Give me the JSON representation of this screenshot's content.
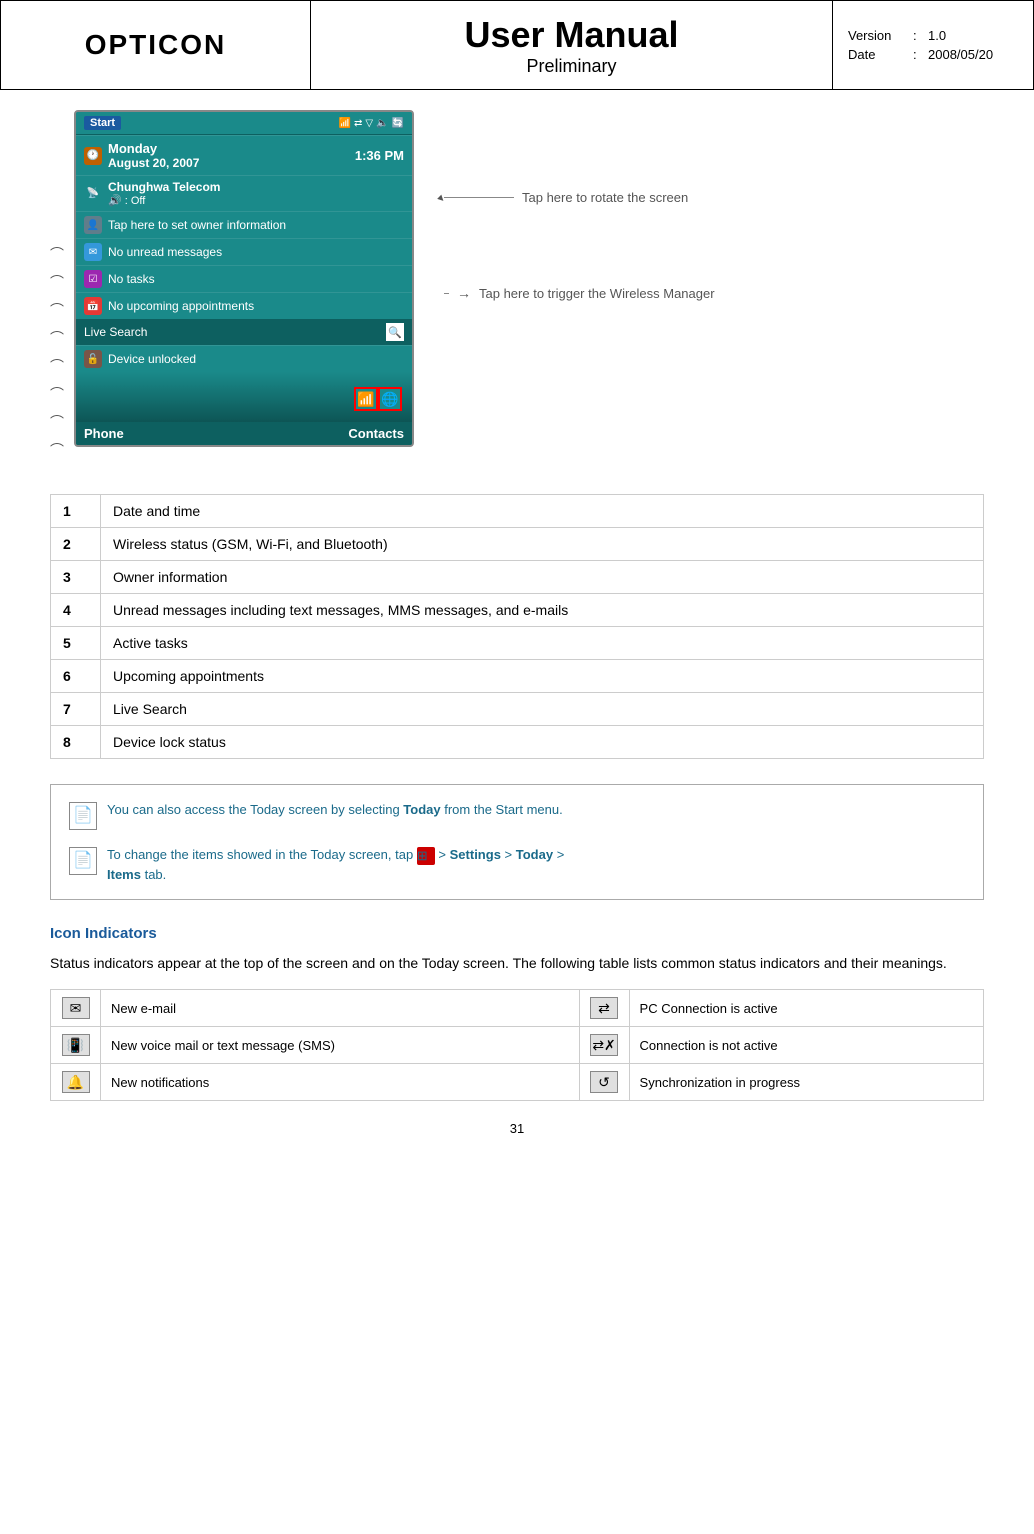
{
  "header": {
    "logo": "OPTICON",
    "title_main": "User Manual",
    "title_sub": "Preliminary",
    "version_label": "Version",
    "version_colon": ":",
    "version_value": "1.0",
    "date_label": "Date",
    "date_colon": ":",
    "date_value": "2008/05/20"
  },
  "phone": {
    "start_label": "Start",
    "day": "Monday",
    "date_str": "August 20, 2007",
    "time": "1:36 PM",
    "wireless_label": "Chunghwa Telecom",
    "wireless_sub": "🔊 : Off",
    "owner_label": "Tap here to set owner information",
    "messages_label": "No unread messages",
    "tasks_label": "No tasks",
    "appointments_label": "No upcoming appointments",
    "live_search": "Live Search",
    "device_lock": "Device unlocked",
    "phone_btn": "Phone",
    "contacts_btn": "Contacts"
  },
  "annotations": {
    "rotate_text": "Tap here to rotate the screen",
    "wireless_text": "Tap here to trigger the Wireless Manager"
  },
  "table": {
    "rows": [
      {
        "num": "1",
        "desc": "Date and time"
      },
      {
        "num": "2",
        "desc": "Wireless status (GSM, Wi-Fi, and Bluetooth)"
      },
      {
        "num": "3",
        "desc": "Owner information"
      },
      {
        "num": "4",
        "desc": "Unread messages including text messages, MMS messages, and e-mails"
      },
      {
        "num": "5",
        "desc": "Active tasks"
      },
      {
        "num": "6",
        "desc": "Upcoming appointments"
      },
      {
        "num": "7",
        "desc": "Live Search"
      },
      {
        "num": "8",
        "desc": "Device lock status"
      }
    ]
  },
  "notes": {
    "note1": "You can also access the Today screen by selecting ",
    "note1_bold": "Today",
    "note1_end": " from the Start menu.",
    "note2_start": "To change the items showed in the Today screen, tap ",
    "note2_mid": " > ",
    "note2_bold1": "Settings",
    "note2_mid2": " > ",
    "note2_bold2": "Today",
    "note2_mid3": " > ",
    "note2_bold3": "Items",
    "note2_end": " tab."
  },
  "icon_section": {
    "title": "Icon Indicators",
    "desc": "Status indicators appear at the top of the screen and on the Today screen. The following table lists common status indicators and their meanings.",
    "rows": [
      {
        "icon_left": "✉",
        "label_left": "New e-mail",
        "icon_right": "⇄",
        "label_right": "PC Connection is active"
      },
      {
        "icon_left": "📳",
        "label_left": "New voice mail or text message (SMS)",
        "icon_right": "⇄✗",
        "label_right": "Connection is not active"
      },
      {
        "icon_left": "🔔",
        "label_left": "New notifications",
        "icon_right": "↺",
        "label_right": "Synchronization in progress"
      }
    ]
  },
  "page_number": "31"
}
